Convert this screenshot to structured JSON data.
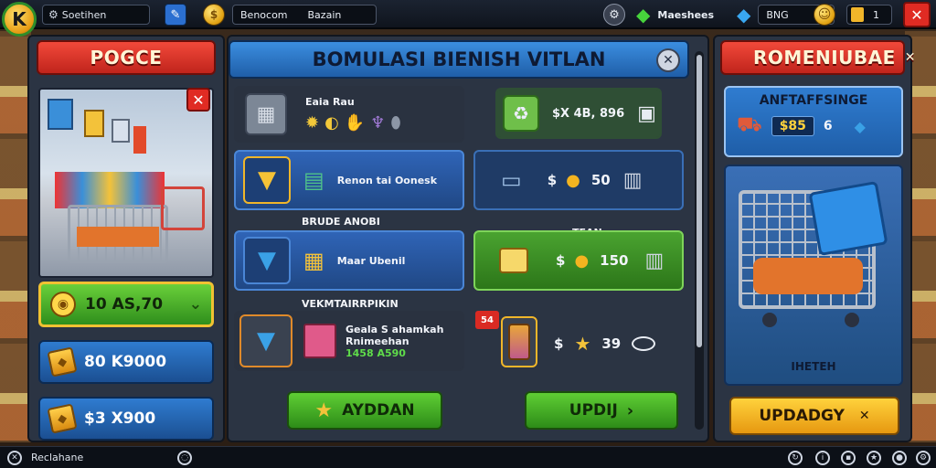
{
  "topbar": {
    "logo": "K",
    "search_label": "Soetihen",
    "store_label": "Benocom",
    "store_value": "Bazain",
    "gems_label": "Maeshees",
    "coins_label": "BNG",
    "level_value": "1",
    "icons": [
      "settings-icon",
      "coin-icon",
      "gear-icon",
      "gem-icon",
      "diamond-icon",
      "smile-icon",
      "level-icon",
      "close-icon"
    ]
  },
  "left": {
    "title": "POGCE",
    "price_green": "10 AS,70",
    "price_row2": "80 K9000",
    "price_row3": "$3 X900"
  },
  "center": {
    "title": "BOMULASI BIENISH VITLAN",
    "row1": {
      "label": "Eaia Rau",
      "price": "$X 4B, 896"
    },
    "row2": {
      "label": "Renon tai Oonesk",
      "dollar": "$",
      "value": "50"
    },
    "section2": "BRUDE ANOBI",
    "row3": {
      "label": "Maar Ubenil",
      "top": "TEAN",
      "dollar": "$",
      "value": "150"
    },
    "section3": "VEKMTAIRRPIKIN",
    "row4": {
      "title": "Geala S ahamkah",
      "subtitle": "Rnimeehan",
      "price": "1458 A590",
      "badge": "54",
      "dollar": "$",
      "value": "39"
    },
    "btn_left": "AYDDAN",
    "btn_right": "UPDIJ"
  },
  "right": {
    "title": "ROMENIUBAE",
    "subtitle": "ANFTAFFSINGE",
    "price": "$85",
    "qty": "6",
    "cart_label": "IHETEH",
    "btn": "UPDADGY"
  },
  "bottombar": {
    "status": "Reclahane"
  }
}
